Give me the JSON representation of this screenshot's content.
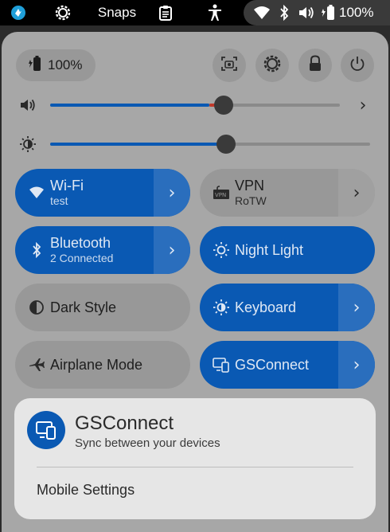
{
  "top_bar": {
    "app_icon": "ubuntu-software-icon",
    "settings_icon": "gear-icon",
    "snaps_label": "Snaps",
    "clipboard_icon": "clipboard-icon",
    "accessibility_icon": "accessibility-icon",
    "status": {
      "wifi_icon": "wifi-icon",
      "bluetooth_icon": "bluetooth-icon",
      "volume_icon": "volume-icon",
      "battery_icon": "battery-charging-icon",
      "battery_label": "100%"
    }
  },
  "quick_settings": {
    "battery_pill": {
      "icon": "battery-charging-icon",
      "label": "100%"
    },
    "buttons": [
      {
        "name": "screenshot",
        "icon": "screenshot-icon"
      },
      {
        "name": "settings",
        "icon": "gear-icon"
      },
      {
        "name": "lock",
        "icon": "lock-icon"
      },
      {
        "name": "power",
        "icon": "power-icon"
      }
    ],
    "volume": {
      "icon": "volume-icon",
      "level": 0.6,
      "over_amplified_start": 0.55,
      "chevron": "›"
    },
    "brightness": {
      "icon": "brightness-icon",
      "level": 0.55
    },
    "toggles": [
      {
        "id": "wifi",
        "title": "Wi-Fi",
        "subtitle": "test",
        "active": true,
        "icon": "wifi-icon",
        "has_arrow": true
      },
      {
        "id": "vpn",
        "title": "VPN",
        "subtitle": "RoTW",
        "active": false,
        "icon": "vpn-icon",
        "has_arrow": true
      },
      {
        "id": "bluetooth",
        "title": "Bluetooth",
        "subtitle": "2 Connected",
        "active": true,
        "icon": "bluetooth-icon",
        "has_arrow": true
      },
      {
        "id": "night-light",
        "title": "Night Light",
        "subtitle": "",
        "active": true,
        "icon": "night-light-icon",
        "has_arrow": false
      },
      {
        "id": "dark-style",
        "title": "Dark Style",
        "subtitle": "",
        "active": false,
        "icon": "dark-style-icon",
        "has_arrow": false
      },
      {
        "id": "keyboard",
        "title": "Keyboard",
        "subtitle": "",
        "active": true,
        "icon": "keyboard-brightness-icon",
        "has_arrow": true
      },
      {
        "id": "airplane",
        "title": "Airplane Mode",
        "subtitle": "",
        "active": false,
        "icon": "airplane-icon",
        "has_arrow": false
      },
      {
        "id": "gsconnect",
        "title": "GSConnect",
        "subtitle": "",
        "active": true,
        "icon": "devices-icon",
        "has_arrow": true
      }
    ],
    "arrow_glyph": "›"
  },
  "submenu": {
    "icon": "devices-icon",
    "title": "GSConnect",
    "subtitle": "Sync between your devices",
    "items": [
      {
        "label": "Mobile Settings"
      }
    ]
  },
  "colors": {
    "accent": "#0a59b3",
    "panel_bg": "#a7a7a7",
    "tile_off": "#989898",
    "over_amplified": "#c0392b"
  }
}
